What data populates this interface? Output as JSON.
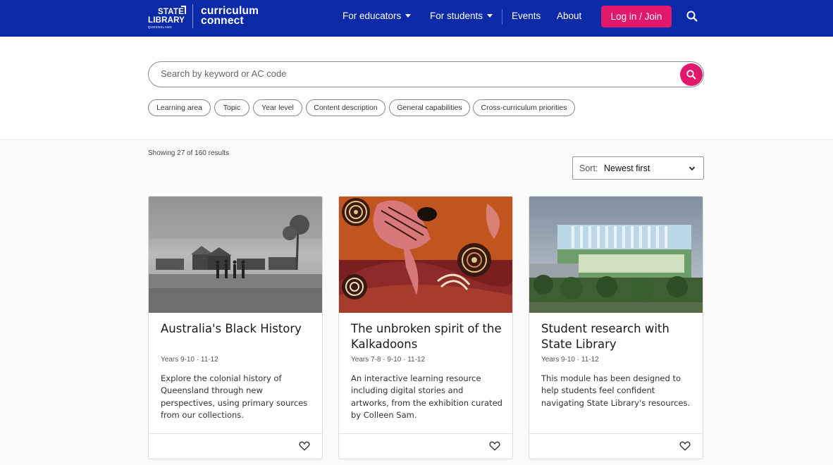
{
  "header": {
    "logo_state_line1": "STATE",
    "logo_state_line2": "LIBRARY",
    "logo_state_line3": "QUEENSLAND",
    "logo_cc_line1": "curriculum",
    "logo_cc_line2": "connect",
    "nav": [
      {
        "label": "For educators",
        "has_dropdown": true
      },
      {
        "label": "For students",
        "has_dropdown": true
      },
      {
        "label": "Events",
        "has_dropdown": false
      },
      {
        "label": "About",
        "has_dropdown": false
      }
    ],
    "login_label": "Log in / Join",
    "search_icon": "search-icon",
    "bg_color": "#0b2aa7",
    "accent_color": "#e2186c"
  },
  "search": {
    "placeholder": "Search by keyword or AC code",
    "value": ""
  },
  "filters": [
    "Learning area",
    "Topic",
    "Year level",
    "Content description",
    "General capabilities",
    "Cross-curriculum priorities"
  ],
  "results": {
    "count_text": "Showing 27 of 160 results",
    "sort_label": "Sort:",
    "sort_value": "Newest first"
  },
  "cards": [
    {
      "title": "Australia's Black History",
      "years": "Years 9-10 · 11-12",
      "description": "Explore the colonial history of Queensland through new perspectives, using primary sources from our collections.",
      "image": "historical-photo",
      "favourite_icon": "heart-icon"
    },
    {
      "title": "The unbroken spirit of the Kalkadoons",
      "years": "Years 7-8 · 9-10 · 11-12",
      "description": "An interactive learning resource including digital stories and artworks, from the exhibition curated by Colleen Sam.",
      "image": "aboriginal-artwork",
      "favourite_icon": "heart-icon"
    },
    {
      "title": "Student research with State Library",
      "years": "Years 9-10 · 11-12",
      "description": "This module has been designed to help students feel confident navigating State Library's resources.",
      "image": "library-building-photo",
      "favourite_icon": "heart-icon"
    }
  ]
}
